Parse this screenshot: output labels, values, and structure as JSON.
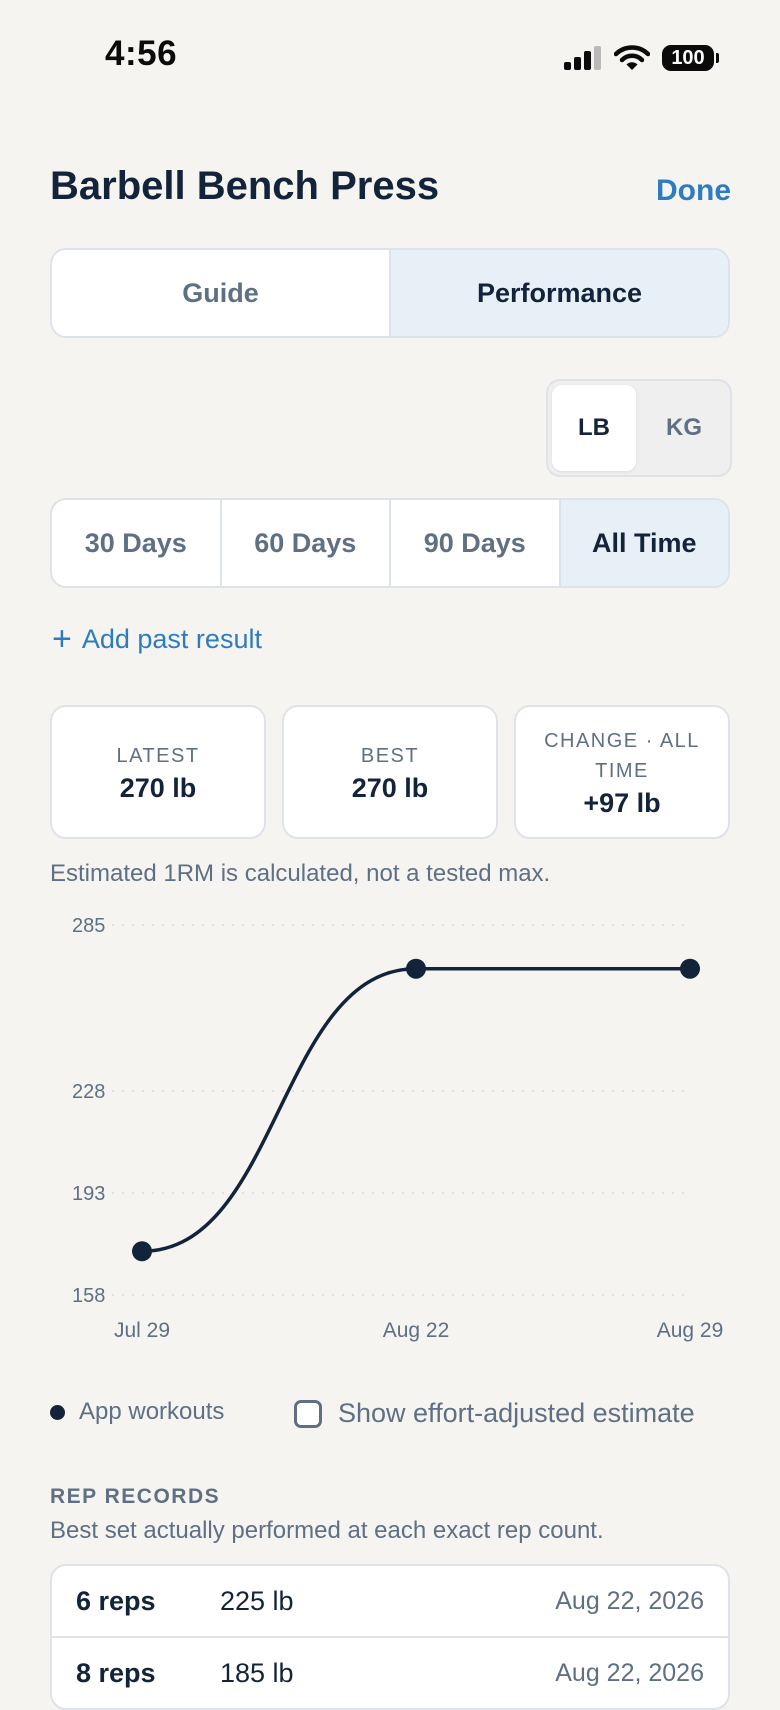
{
  "status": {
    "time": "4:56",
    "battery": "100"
  },
  "header": {
    "title": "Barbell Bench Press",
    "done_label": "Done"
  },
  "tabs": [
    {
      "label": "Guide",
      "active": false
    },
    {
      "label": "Performance",
      "active": true
    }
  ],
  "units": [
    {
      "label": "LB",
      "active": true
    },
    {
      "label": "KG",
      "active": false
    }
  ],
  "ranges": [
    {
      "label": "30 Days",
      "active": false
    },
    {
      "label": "60 Days",
      "active": false
    },
    {
      "label": "90 Days",
      "active": false
    },
    {
      "label": "All Time",
      "active": true
    }
  ],
  "add_past_result": "Add past result",
  "stats": [
    {
      "label": "LATEST",
      "value": "270 lb"
    },
    {
      "label": "BEST",
      "value": "270 lb"
    },
    {
      "label": "CHANGE · ALL TIME",
      "value": "+97 lb"
    }
  ],
  "note": "Estimated 1RM is calculated, not a tested max.",
  "chart_data": {
    "type": "line",
    "x": [
      "Jul 29",
      "Aug 22",
      "Aug 29"
    ],
    "y_ticks": [
      285,
      228,
      193,
      158
    ],
    "ylim": [
      158,
      285
    ],
    "series": [
      {
        "name": "App workouts",
        "values": [
          173,
          270,
          270
        ],
        "color": "#13243a"
      }
    ],
    "grid": true
  },
  "legend": {
    "label": "App workouts"
  },
  "effort_toggle": {
    "label": "Show effort-adjusted estimate",
    "checked": false
  },
  "rep_records": {
    "title": "REP RECORDS",
    "subtitle": "Best set actually performed at each exact rep count.",
    "rows": [
      {
        "reps": "6 reps",
        "weight": "225 lb",
        "date": "Aug 22, 2026"
      },
      {
        "reps": "8 reps",
        "weight": "185 lb",
        "date": "Aug 22, 2026"
      }
    ]
  },
  "colors": {
    "accent": "#2f7bbf",
    "ink": "#13243a",
    "muted": "#5f6f84",
    "background": "#f5f4f0",
    "active_segment": "#e8f0f7"
  }
}
